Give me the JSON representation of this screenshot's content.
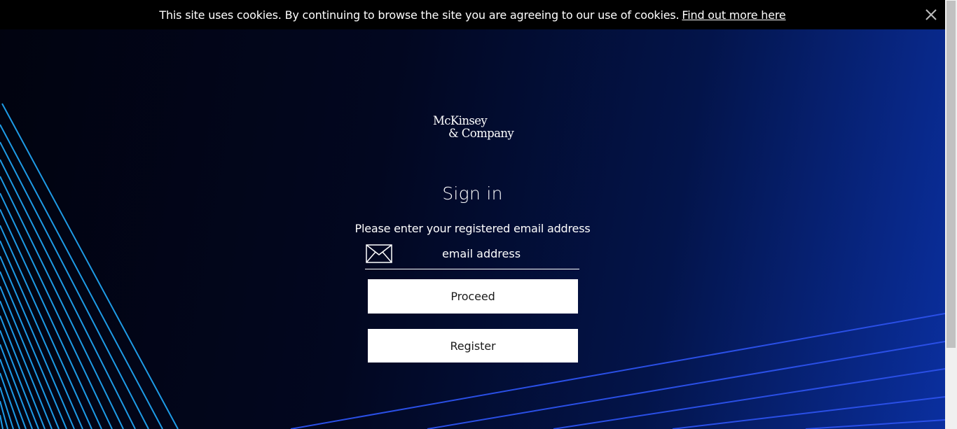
{
  "cookie_banner": {
    "message": "This site uses cookies. By continuing to browse the site you are agreeing to our use of cookies.",
    "link_label": "Find out more here",
    "close_icon": "close-icon"
  },
  "logo": {
    "line1": "McKinsey",
    "line2": "& Company"
  },
  "signin": {
    "title": "Sign in",
    "instruction": "Please enter your registered email address",
    "email_placeholder": "email address",
    "email_value": "",
    "email_icon": "envelope-icon",
    "proceed_label": "Proceed",
    "register_label": "Register"
  },
  "colors": {
    "background_dark": "#020720",
    "background_accent": "#0a2f9f",
    "line_cyan": "#1e9be6",
    "line_blue": "#2a4fe6",
    "button_bg": "#ffffff",
    "cookie_bar_bg": "#000000"
  }
}
